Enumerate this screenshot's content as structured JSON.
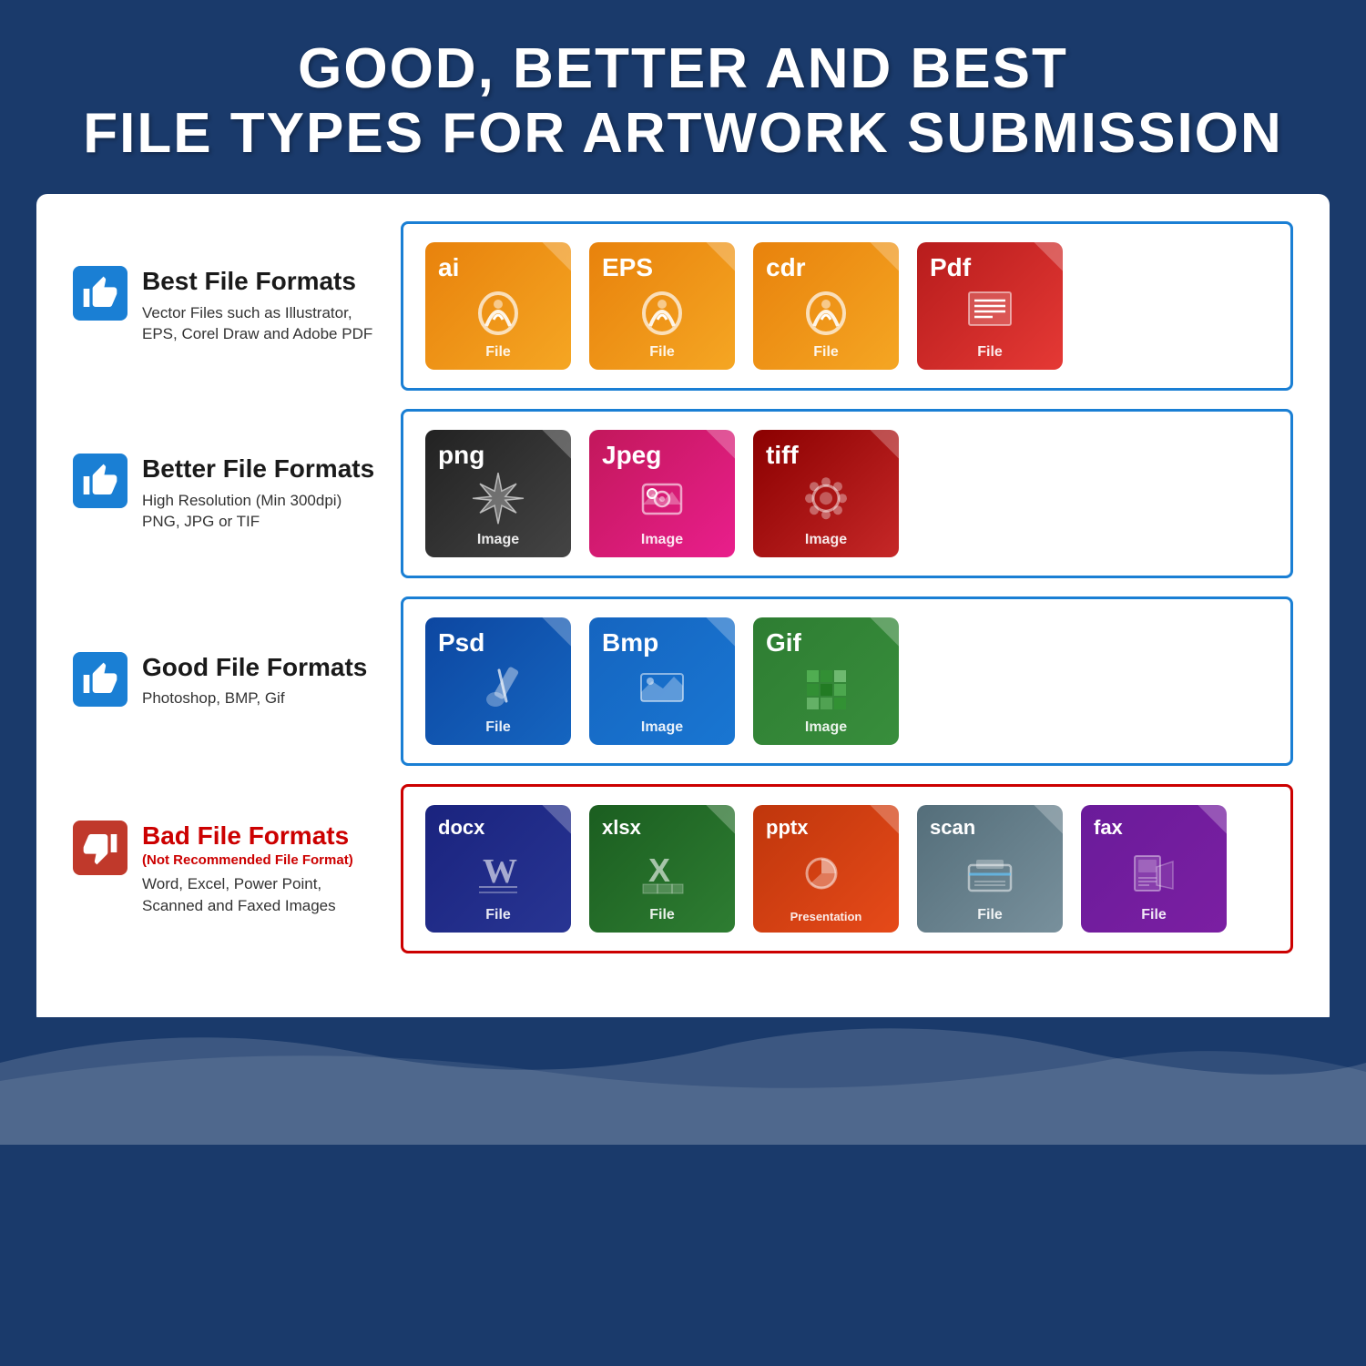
{
  "header": {
    "line1": "GOOD, BETTER AND BEST",
    "line2": "FILE TYPES FOR ARTWORK SUBMISSION"
  },
  "sections": [
    {
      "id": "best",
      "rating": "best",
      "icon_type": "thumbs-up",
      "title": "Best File Formats",
      "subtitle": null,
      "description": "Vector Files such as Illustrator,\nEPS, Corel Draw and Adobe PDF",
      "border_color": "#1a7fd4",
      "files": [
        {
          "ext": "ai",
          "label": "File",
          "color": "orange",
          "icon": "pen"
        },
        {
          "ext": "EPS",
          "label": "File",
          "color": "orange",
          "icon": "pen"
        },
        {
          "ext": "cdr",
          "label": "File",
          "color": "orange",
          "icon": "pen"
        },
        {
          "ext": "Pdf",
          "label": "File",
          "color": "red",
          "icon": "doc"
        }
      ]
    },
    {
      "id": "better",
      "rating": "better",
      "icon_type": "thumbs-up",
      "title": "Better File Formats",
      "subtitle": null,
      "description": "High Resolution (Min 300dpi)\nPNG, JPG or TIF",
      "border_color": "#1a7fd4",
      "files": [
        {
          "ext": "png",
          "label": "Image",
          "color": "dark",
          "icon": "star"
        },
        {
          "ext": "Jpeg",
          "label": "Image",
          "color": "pink",
          "icon": "camera"
        },
        {
          "ext": "tiff",
          "label": "Image",
          "color": "darkred",
          "icon": "gear"
        }
      ]
    },
    {
      "id": "good",
      "rating": "good",
      "icon_type": "thumbs-up",
      "title": "Good File Formats",
      "subtitle": null,
      "description": "Photoshop, BMP, Gif",
      "border_color": "#1a7fd4",
      "files": [
        {
          "ext": "Psd",
          "label": "File",
          "color": "darkblue",
          "icon": "brush"
        },
        {
          "ext": "Bmp",
          "label": "Image",
          "color": "blue",
          "icon": "mountain"
        },
        {
          "ext": "Gif",
          "label": "Image",
          "color": "green",
          "icon": "grid"
        }
      ]
    },
    {
      "id": "bad",
      "rating": "bad",
      "icon_type": "thumbs-down",
      "title": "Bad File Formats",
      "subtitle": "(Not Recommended File Format)",
      "description": "Word, Excel, Power Point,\nScanned and Faxed Images",
      "border_color": "#cc0000",
      "files": [
        {
          "ext": "docx",
          "label": "File",
          "color": "navy",
          "icon": "word"
        },
        {
          "ext": "xlsx",
          "label": "File",
          "color": "green",
          "icon": "excel"
        },
        {
          "ext": "pptx",
          "label": "Presentation",
          "color": "darkorange",
          "icon": "ppt"
        },
        {
          "ext": "scan",
          "label": "File",
          "color": "gray",
          "icon": "scanner"
        },
        {
          "ext": "fax",
          "label": "File",
          "color": "purple",
          "icon": "fax"
        }
      ]
    }
  ]
}
